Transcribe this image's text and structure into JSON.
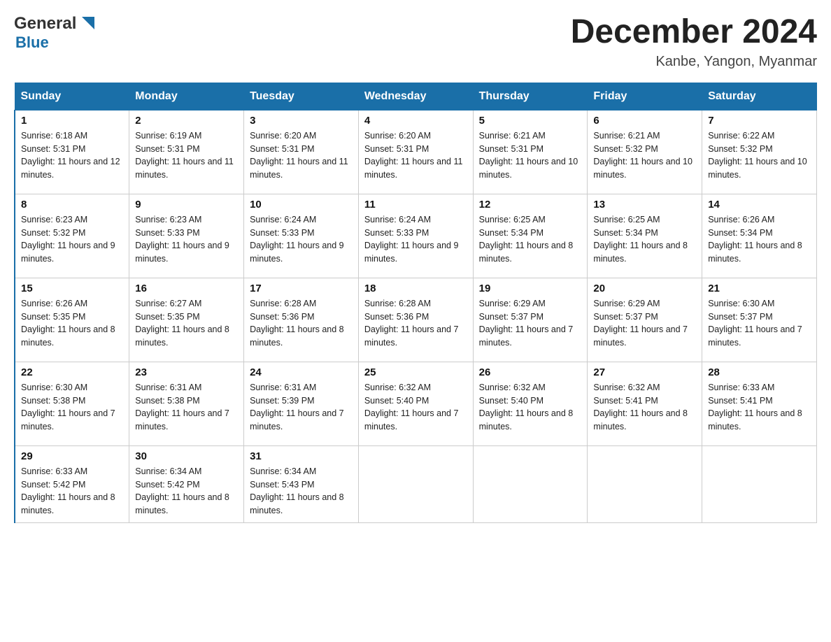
{
  "header": {
    "logo_general": "General",
    "logo_blue": "Blue",
    "month_title": "December 2024",
    "location": "Kanbe, Yangon, Myanmar"
  },
  "days_of_week": [
    "Sunday",
    "Monday",
    "Tuesday",
    "Wednesday",
    "Thursday",
    "Friday",
    "Saturday"
  ],
  "weeks": [
    [
      {
        "day": "1",
        "sunrise": "Sunrise: 6:18 AM",
        "sunset": "Sunset: 5:31 PM",
        "daylight": "Daylight: 11 hours and 12 minutes."
      },
      {
        "day": "2",
        "sunrise": "Sunrise: 6:19 AM",
        "sunset": "Sunset: 5:31 PM",
        "daylight": "Daylight: 11 hours and 11 minutes."
      },
      {
        "day": "3",
        "sunrise": "Sunrise: 6:20 AM",
        "sunset": "Sunset: 5:31 PM",
        "daylight": "Daylight: 11 hours and 11 minutes."
      },
      {
        "day": "4",
        "sunrise": "Sunrise: 6:20 AM",
        "sunset": "Sunset: 5:31 PM",
        "daylight": "Daylight: 11 hours and 11 minutes."
      },
      {
        "day": "5",
        "sunrise": "Sunrise: 6:21 AM",
        "sunset": "Sunset: 5:31 PM",
        "daylight": "Daylight: 11 hours and 10 minutes."
      },
      {
        "day": "6",
        "sunrise": "Sunrise: 6:21 AM",
        "sunset": "Sunset: 5:32 PM",
        "daylight": "Daylight: 11 hours and 10 minutes."
      },
      {
        "day": "7",
        "sunrise": "Sunrise: 6:22 AM",
        "sunset": "Sunset: 5:32 PM",
        "daylight": "Daylight: 11 hours and 10 minutes."
      }
    ],
    [
      {
        "day": "8",
        "sunrise": "Sunrise: 6:23 AM",
        "sunset": "Sunset: 5:32 PM",
        "daylight": "Daylight: 11 hours and 9 minutes."
      },
      {
        "day": "9",
        "sunrise": "Sunrise: 6:23 AM",
        "sunset": "Sunset: 5:33 PM",
        "daylight": "Daylight: 11 hours and 9 minutes."
      },
      {
        "day": "10",
        "sunrise": "Sunrise: 6:24 AM",
        "sunset": "Sunset: 5:33 PM",
        "daylight": "Daylight: 11 hours and 9 minutes."
      },
      {
        "day": "11",
        "sunrise": "Sunrise: 6:24 AM",
        "sunset": "Sunset: 5:33 PM",
        "daylight": "Daylight: 11 hours and 9 minutes."
      },
      {
        "day": "12",
        "sunrise": "Sunrise: 6:25 AM",
        "sunset": "Sunset: 5:34 PM",
        "daylight": "Daylight: 11 hours and 8 minutes."
      },
      {
        "day": "13",
        "sunrise": "Sunrise: 6:25 AM",
        "sunset": "Sunset: 5:34 PM",
        "daylight": "Daylight: 11 hours and 8 minutes."
      },
      {
        "day": "14",
        "sunrise": "Sunrise: 6:26 AM",
        "sunset": "Sunset: 5:34 PM",
        "daylight": "Daylight: 11 hours and 8 minutes."
      }
    ],
    [
      {
        "day": "15",
        "sunrise": "Sunrise: 6:26 AM",
        "sunset": "Sunset: 5:35 PM",
        "daylight": "Daylight: 11 hours and 8 minutes."
      },
      {
        "day": "16",
        "sunrise": "Sunrise: 6:27 AM",
        "sunset": "Sunset: 5:35 PM",
        "daylight": "Daylight: 11 hours and 8 minutes."
      },
      {
        "day": "17",
        "sunrise": "Sunrise: 6:28 AM",
        "sunset": "Sunset: 5:36 PM",
        "daylight": "Daylight: 11 hours and 8 minutes."
      },
      {
        "day": "18",
        "sunrise": "Sunrise: 6:28 AM",
        "sunset": "Sunset: 5:36 PM",
        "daylight": "Daylight: 11 hours and 7 minutes."
      },
      {
        "day": "19",
        "sunrise": "Sunrise: 6:29 AM",
        "sunset": "Sunset: 5:37 PM",
        "daylight": "Daylight: 11 hours and 7 minutes."
      },
      {
        "day": "20",
        "sunrise": "Sunrise: 6:29 AM",
        "sunset": "Sunset: 5:37 PM",
        "daylight": "Daylight: 11 hours and 7 minutes."
      },
      {
        "day": "21",
        "sunrise": "Sunrise: 6:30 AM",
        "sunset": "Sunset: 5:37 PM",
        "daylight": "Daylight: 11 hours and 7 minutes."
      }
    ],
    [
      {
        "day": "22",
        "sunrise": "Sunrise: 6:30 AM",
        "sunset": "Sunset: 5:38 PM",
        "daylight": "Daylight: 11 hours and 7 minutes."
      },
      {
        "day": "23",
        "sunrise": "Sunrise: 6:31 AM",
        "sunset": "Sunset: 5:38 PM",
        "daylight": "Daylight: 11 hours and 7 minutes."
      },
      {
        "day": "24",
        "sunrise": "Sunrise: 6:31 AM",
        "sunset": "Sunset: 5:39 PM",
        "daylight": "Daylight: 11 hours and 7 minutes."
      },
      {
        "day": "25",
        "sunrise": "Sunrise: 6:32 AM",
        "sunset": "Sunset: 5:40 PM",
        "daylight": "Daylight: 11 hours and 7 minutes."
      },
      {
        "day": "26",
        "sunrise": "Sunrise: 6:32 AM",
        "sunset": "Sunset: 5:40 PM",
        "daylight": "Daylight: 11 hours and 8 minutes."
      },
      {
        "day": "27",
        "sunrise": "Sunrise: 6:32 AM",
        "sunset": "Sunset: 5:41 PM",
        "daylight": "Daylight: 11 hours and 8 minutes."
      },
      {
        "day": "28",
        "sunrise": "Sunrise: 6:33 AM",
        "sunset": "Sunset: 5:41 PM",
        "daylight": "Daylight: 11 hours and 8 minutes."
      }
    ],
    [
      {
        "day": "29",
        "sunrise": "Sunrise: 6:33 AM",
        "sunset": "Sunset: 5:42 PM",
        "daylight": "Daylight: 11 hours and 8 minutes."
      },
      {
        "day": "30",
        "sunrise": "Sunrise: 6:34 AM",
        "sunset": "Sunset: 5:42 PM",
        "daylight": "Daylight: 11 hours and 8 minutes."
      },
      {
        "day": "31",
        "sunrise": "Sunrise: 6:34 AM",
        "sunset": "Sunset: 5:43 PM",
        "daylight": "Daylight: 11 hours and 8 minutes."
      },
      {
        "day": "",
        "sunrise": "",
        "sunset": "",
        "daylight": ""
      },
      {
        "day": "",
        "sunrise": "",
        "sunset": "",
        "daylight": ""
      },
      {
        "day": "",
        "sunrise": "",
        "sunset": "",
        "daylight": ""
      },
      {
        "day": "",
        "sunrise": "",
        "sunset": "",
        "daylight": ""
      }
    ]
  ]
}
